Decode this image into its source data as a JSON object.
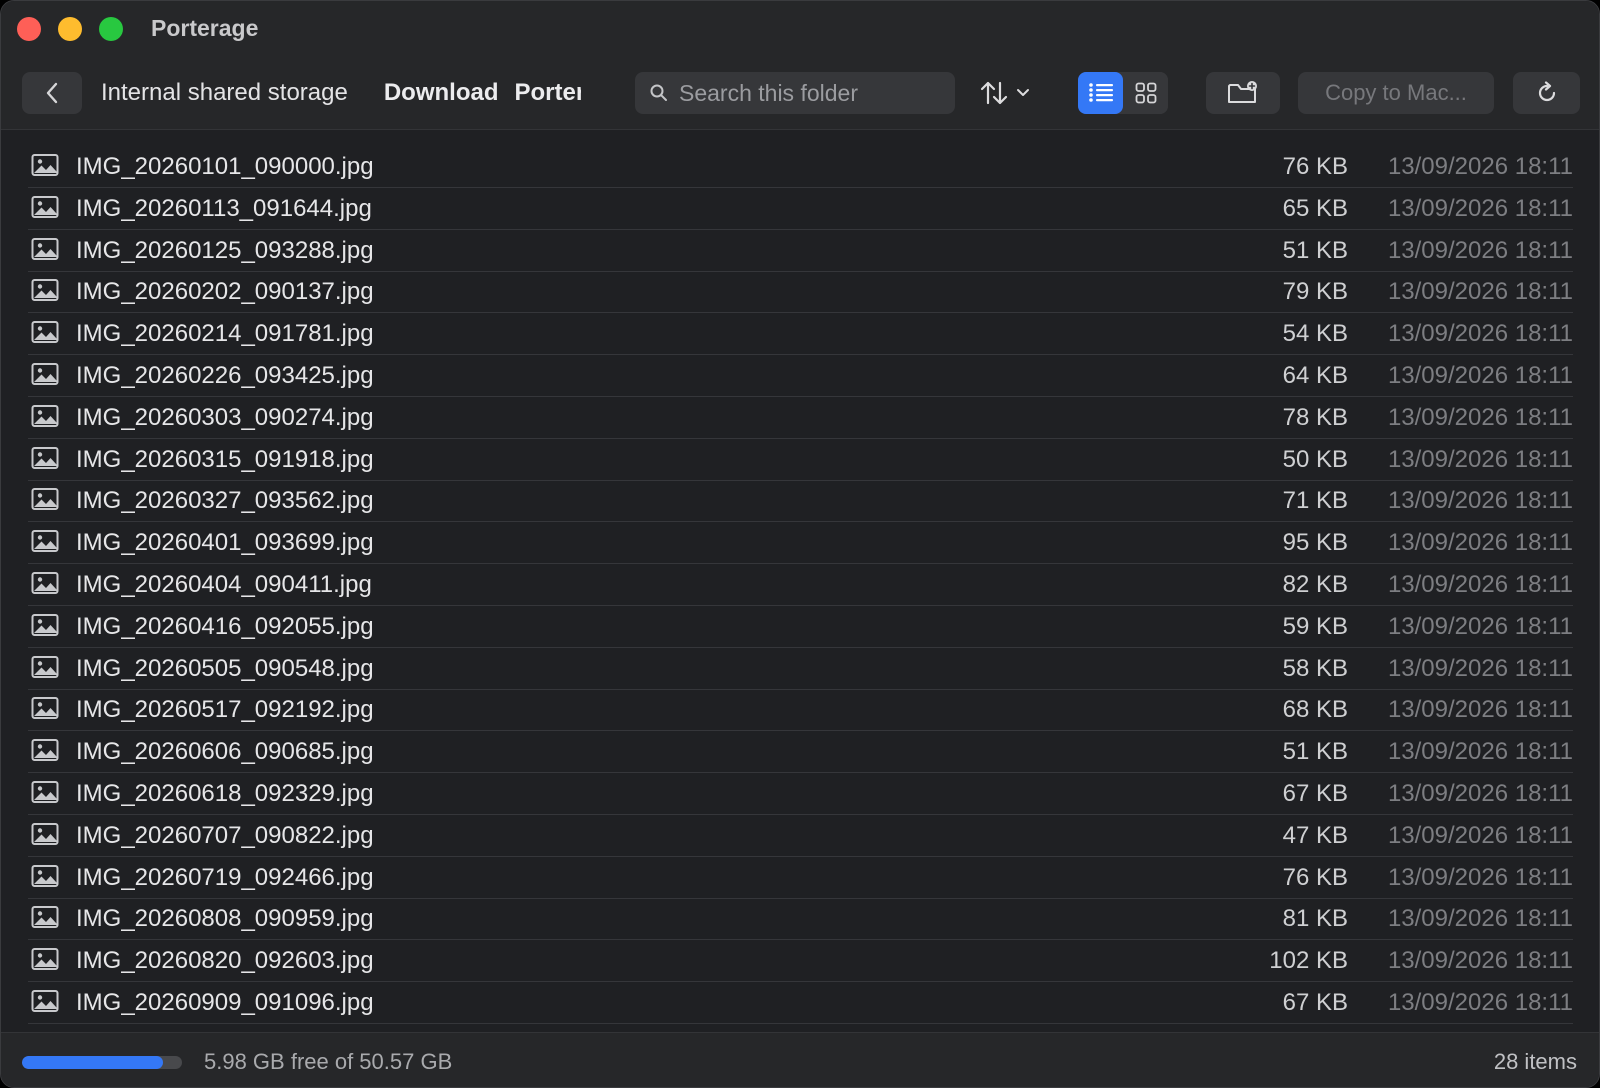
{
  "window": {
    "title": "Porterage"
  },
  "toolbar": {
    "breadcrumbs": [
      "Internal shared storage",
      "Download",
      "Porterage"
    ],
    "search_placeholder": "Search this folder",
    "copy_label": "Copy to Mac...",
    "view_mode": "list"
  },
  "files": [
    {
      "name": "IMG_20260101_090000.jpg",
      "size": "76 KB",
      "date": "13/09/2026 18:11"
    },
    {
      "name": "IMG_20260113_091644.jpg",
      "size": "65 KB",
      "date": "13/09/2026 18:11"
    },
    {
      "name": "IMG_20260125_093288.jpg",
      "size": "51 KB",
      "date": "13/09/2026 18:11"
    },
    {
      "name": "IMG_20260202_090137.jpg",
      "size": "79 KB",
      "date": "13/09/2026 18:11"
    },
    {
      "name": "IMG_20260214_091781.jpg",
      "size": "54 KB",
      "date": "13/09/2026 18:11"
    },
    {
      "name": "IMG_20260226_093425.jpg",
      "size": "64 KB",
      "date": "13/09/2026 18:11"
    },
    {
      "name": "IMG_20260303_090274.jpg",
      "size": "78 KB",
      "date": "13/09/2026 18:11"
    },
    {
      "name": "IMG_20260315_091918.jpg",
      "size": "50 KB",
      "date": "13/09/2026 18:11"
    },
    {
      "name": "IMG_20260327_093562.jpg",
      "size": "71 KB",
      "date": "13/09/2026 18:11"
    },
    {
      "name": "IMG_20260401_093699.jpg",
      "size": "95 KB",
      "date": "13/09/2026 18:11"
    },
    {
      "name": "IMG_20260404_090411.jpg",
      "size": "82 KB",
      "date": "13/09/2026 18:11"
    },
    {
      "name": "IMG_20260416_092055.jpg",
      "size": "59 KB",
      "date": "13/09/2026 18:11"
    },
    {
      "name": "IMG_20260505_090548.jpg",
      "size": "58 KB",
      "date": "13/09/2026 18:11"
    },
    {
      "name": "IMG_20260517_092192.jpg",
      "size": "68 KB",
      "date": "13/09/2026 18:11"
    },
    {
      "name": "IMG_20260606_090685.jpg",
      "size": "51 KB",
      "date": "13/09/2026 18:11"
    },
    {
      "name": "IMG_20260618_092329.jpg",
      "size": "67 KB",
      "date": "13/09/2026 18:11"
    },
    {
      "name": "IMG_20260707_090822.jpg",
      "size": "47 KB",
      "date": "13/09/2026 18:11"
    },
    {
      "name": "IMG_20260719_092466.jpg",
      "size": "76 KB",
      "date": "13/09/2026 18:11"
    },
    {
      "name": "IMG_20260808_090959.jpg",
      "size": "81 KB",
      "date": "13/09/2026 18:11"
    },
    {
      "name": "IMG_20260820_092603.jpg",
      "size": "102 KB",
      "date": "13/09/2026 18:11"
    },
    {
      "name": "IMG_20260909_091096.jpg",
      "size": "67 KB",
      "date": "13/09/2026 18:11"
    }
  ],
  "status": {
    "storage_text": "5.98 GB free of 50.57 GB",
    "used_fraction": 0.882,
    "item_count": "28 items"
  },
  "colors": {
    "accent": "#3478f6",
    "background": "#1f2023",
    "traffic_red": "#fe5f57",
    "traffic_yellow": "#febc2e",
    "traffic_green": "#28c840"
  }
}
